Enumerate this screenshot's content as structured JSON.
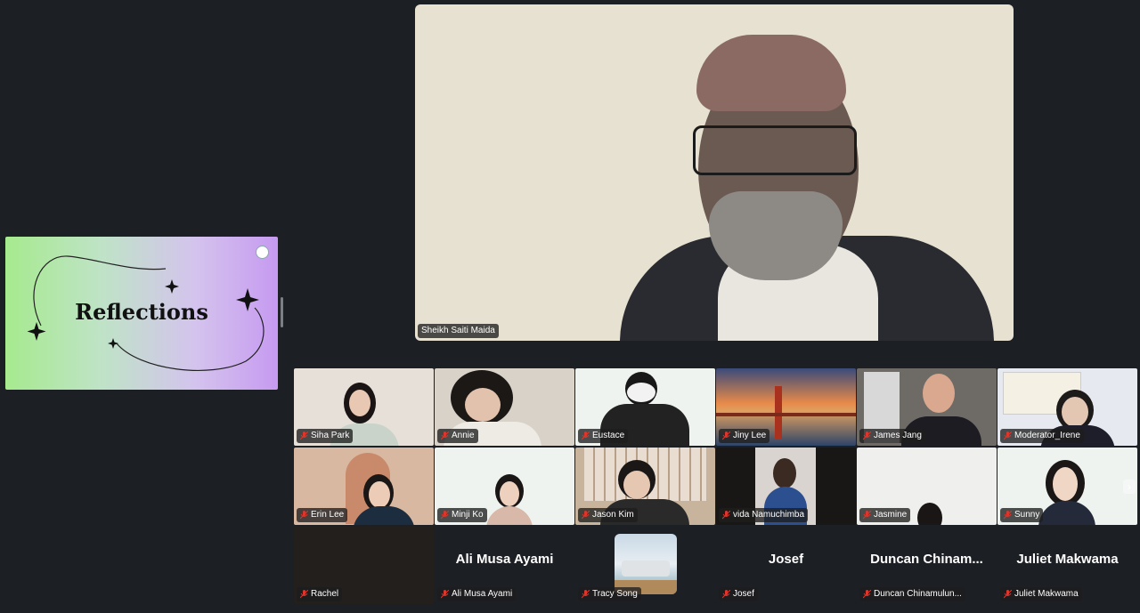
{
  "shared_screen": {
    "title": "Reflections"
  },
  "speaker": {
    "name": "Sheikh Saiti Maida"
  },
  "participants": [
    {
      "name": "Siha Park"
    },
    {
      "name": "Annie"
    },
    {
      "name": "Eustace"
    },
    {
      "name": "Jiny Lee"
    },
    {
      "name": "James Jang"
    },
    {
      "name": "Moderator_Irene"
    },
    {
      "name": "Erin Lee"
    },
    {
      "name": "Minji Ko"
    },
    {
      "name": "Jason Kim"
    },
    {
      "name": "vida Namuchimba"
    },
    {
      "name": "Jasmine"
    },
    {
      "name": "Sunny"
    },
    {
      "name": "Rachel",
      "display": ""
    },
    {
      "name": "Ali Musa Ayami",
      "display": "Ali Musa Ayami"
    },
    {
      "name": "Tracy Song",
      "display": ""
    },
    {
      "name": "Josef",
      "display": "Josef"
    },
    {
      "name": "Duncan Chinamulun...",
      "display": "Duncan  Chinam..."
    },
    {
      "name": "Juliet Makwama",
      "display": "Juliet Makwama"
    }
  ],
  "icons": {
    "mic": "mic-muted-icon",
    "next": "chevron-right-icon"
  },
  "colors": {
    "background": "#1c1f24",
    "muted_red": "#e0352b"
  }
}
